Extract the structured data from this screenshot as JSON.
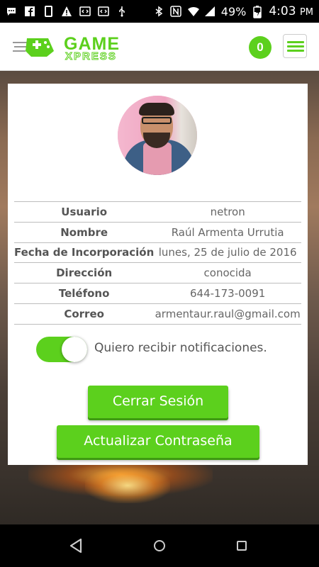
{
  "status_bar": {
    "battery_percent": "49%",
    "time": "4:03",
    "time_suffix": "PM",
    "left_icons": [
      "chat-icon",
      "facebook-icon",
      "phone-icon",
      "warning-icon",
      "code-icon",
      "code-icon",
      "usb-icon"
    ],
    "right_icons": [
      "bluetooth-icon",
      "nfc-icon",
      "wifi-icon",
      "signal-icon",
      "battery-charging-icon"
    ]
  },
  "header": {
    "logo_title": "GAME",
    "logo_subtitle": "XPRESS",
    "cart_count": "0",
    "accent_color": "#5cd01d"
  },
  "profile": {
    "rows": [
      {
        "label": "Usuario",
        "value": "netron"
      },
      {
        "label": "Nombre",
        "value": "Raúl Armenta Urrutia"
      },
      {
        "label": "Fecha de Incorporación",
        "value": "lunes, 25 de julio de 2016"
      },
      {
        "label": "Dirección",
        "value": "conocida"
      },
      {
        "label": "Teléfono",
        "value": "644-173-0091"
      },
      {
        "label": "Correo",
        "value": "armentaur.raul@gmail.com"
      }
    ],
    "notifications_label": "Quiero recibir notificaciones.",
    "notifications_enabled": true,
    "logout_label": "Cerrar Sesión",
    "update_password_label": "Actualizar Contraseña"
  }
}
